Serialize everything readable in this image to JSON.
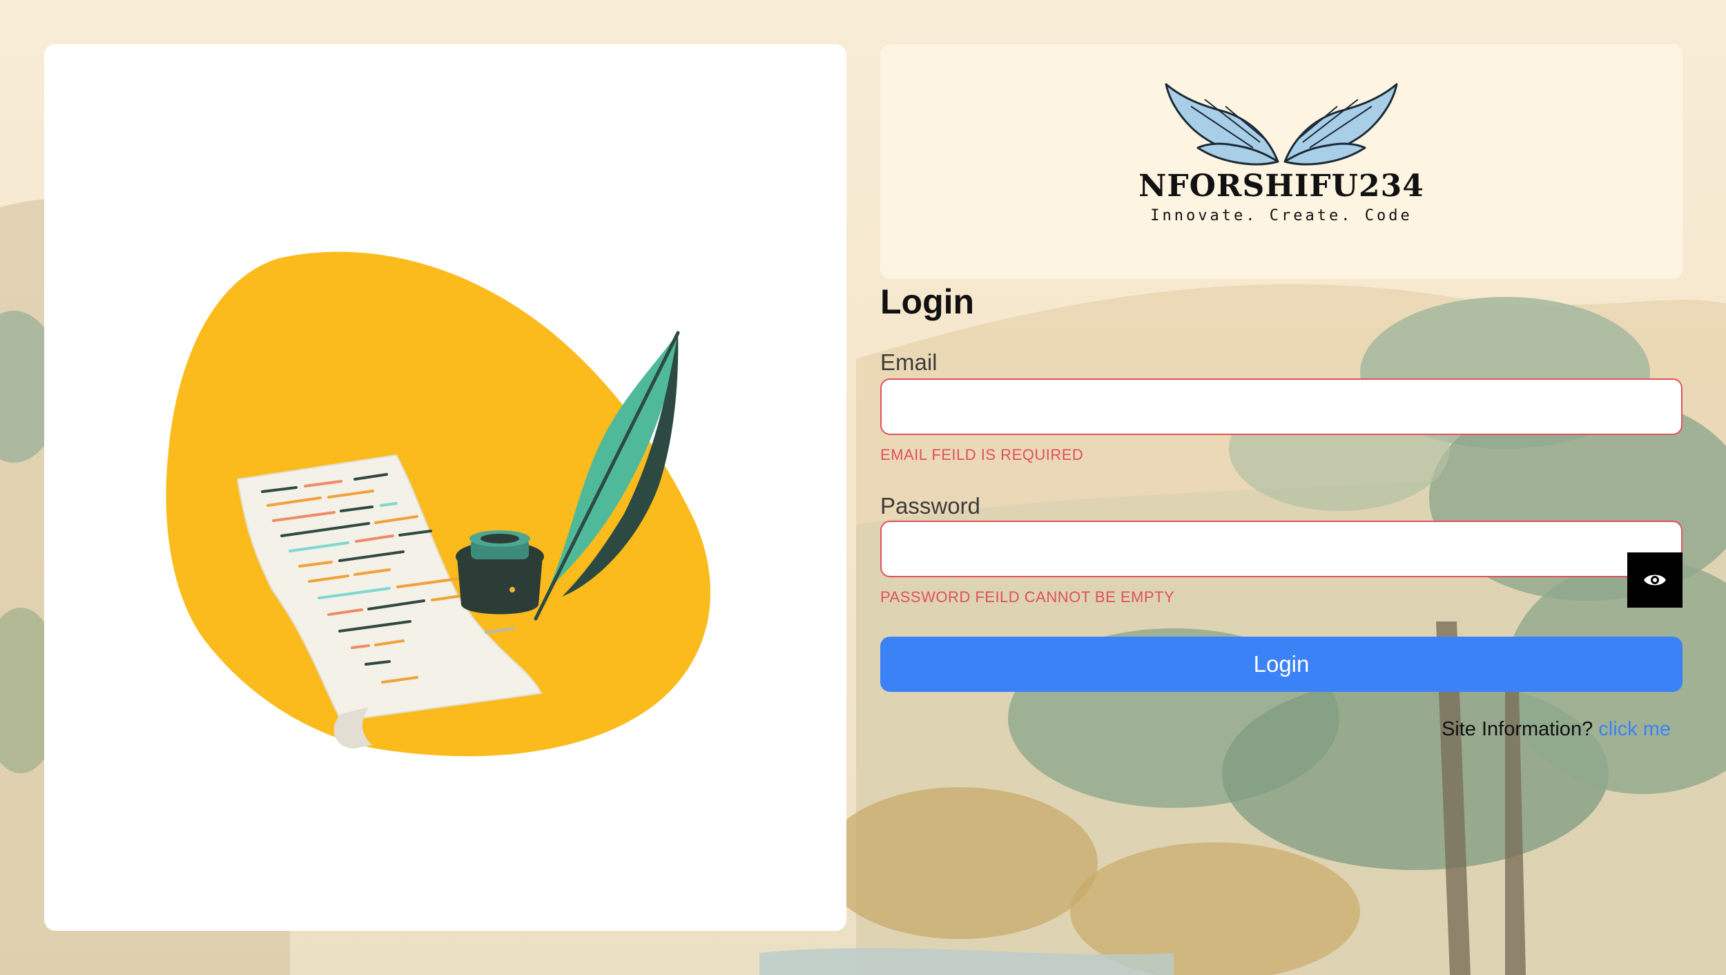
{
  "illustration": {
    "icons": [
      "blob-icon",
      "scroll-icon",
      "ink-pot-icon",
      "quill-icon"
    ]
  },
  "brand": {
    "name": "NFORSHIFU234",
    "tagline": "Innovate. Create. Code",
    "logo_icon": "wings-icon"
  },
  "form": {
    "heading": "Login",
    "email": {
      "label": "Email",
      "value": "",
      "error": "EMAIL FEILD IS REQUIRED"
    },
    "password": {
      "label": "Password",
      "value": "",
      "error": "PASSWORD FEILD CANNOT BE EMPTY",
      "toggle_icon": "eye-icon"
    },
    "submit_label": "Login",
    "site_info_text": "Site Information?",
    "site_info_link": "click me"
  },
  "colors": {
    "accent": "#3b82f6",
    "error": "#e0525a",
    "illustration_yellow": "#fcbb1c"
  }
}
